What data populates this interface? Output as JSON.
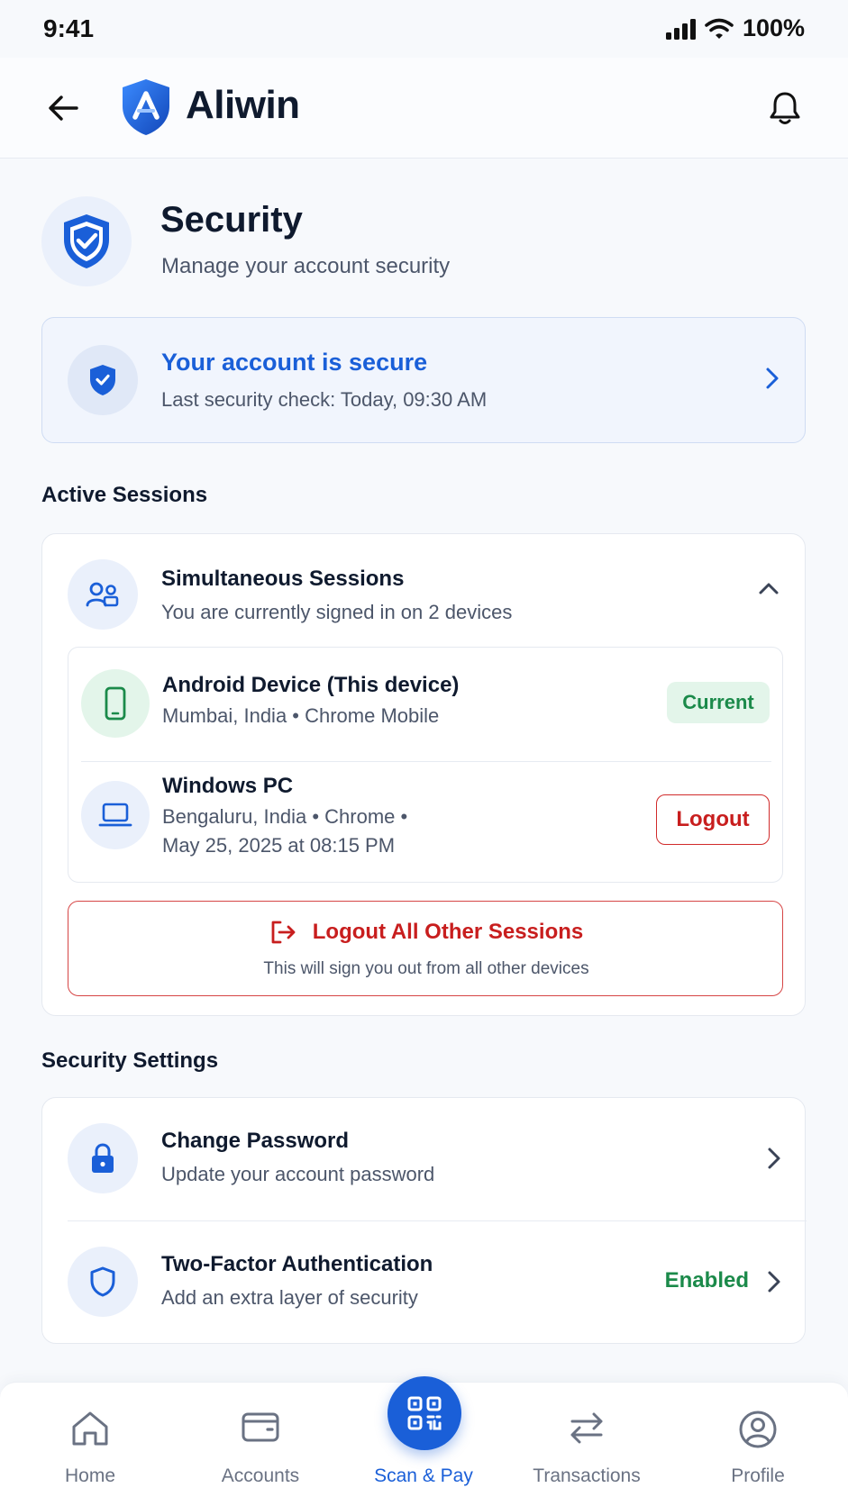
{
  "status_bar": {
    "time": "9:41",
    "battery": "100%"
  },
  "header": {
    "app_name": "Aliwin",
    "back_icon": "arrow-left-icon",
    "bell_icon": "bell-icon",
    "logo_icon": "shield-logo-icon"
  },
  "page": {
    "title": "Security",
    "subtitle": "Manage your account security"
  },
  "secure_banner": {
    "title": "Your account is secure",
    "subtitle": "Last security check: Today, 09:30 AM"
  },
  "sessions": {
    "section_title": "Active Sessions",
    "title": "Simultaneous Sessions",
    "subtitle": "You are currently signed in on 2 devices",
    "devices": [
      {
        "name": "Android Device (This device)",
        "meta_line1": "Mumbai, India • Chrome Mobile",
        "meta_line2": "",
        "badge": "Current",
        "icon": "smartphone-icon"
      },
      {
        "name": "Windows PC",
        "meta_line1": "Bengaluru, India • Chrome •",
        "meta_line2": "May 25, 2025 at 08:15 PM",
        "action": "Logout",
        "icon": "laptop-icon"
      }
    ],
    "logout_all": {
      "label": "Logout All Other Sessions",
      "subtitle": "This will sign you out from all other devices"
    }
  },
  "settings": {
    "section_title": "Security Settings",
    "items": [
      {
        "title": "Change Password",
        "subtitle": "Update your account password"
      },
      {
        "title": "Two-Factor Authentication",
        "subtitle": "Add an extra layer of security",
        "status": "Enabled"
      }
    ]
  },
  "bottom_nav": {
    "items": [
      {
        "label": "Home"
      },
      {
        "label": "Accounts"
      },
      {
        "label": "Scan & Pay"
      },
      {
        "label": "Transactions"
      },
      {
        "label": "Profile"
      }
    ],
    "active": "Scan & Pay"
  },
  "colors": {
    "primary": "#1a5fd8",
    "danger": "#c81e1e",
    "success": "#1b8a4a"
  }
}
